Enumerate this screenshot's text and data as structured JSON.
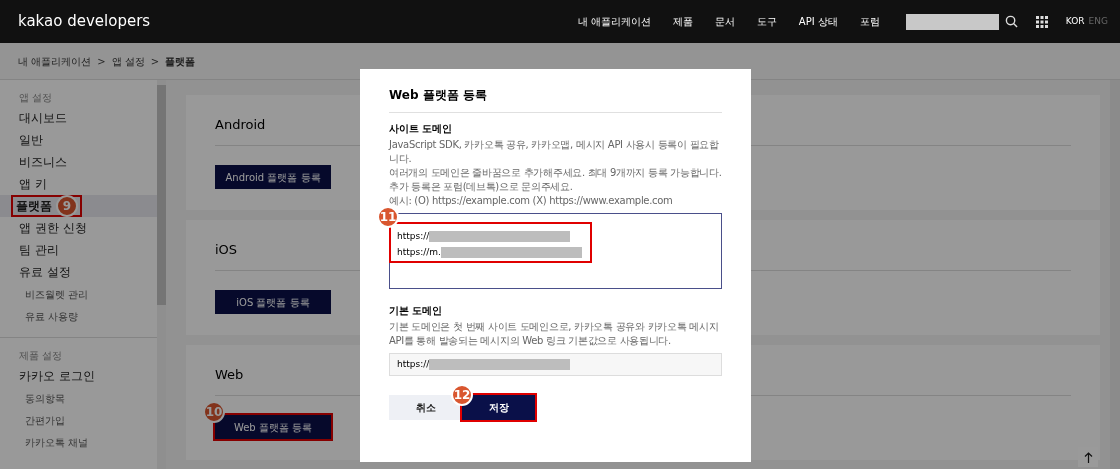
{
  "header": {
    "logo": "kakao developers",
    "nav": [
      {
        "label": "내 애플리케이션"
      },
      {
        "label": "제품"
      },
      {
        "label": "문서"
      },
      {
        "label": "도구"
      },
      {
        "label": "API 상태"
      },
      {
        "label": "포럼"
      }
    ],
    "languages": [
      {
        "label": "KOR",
        "selected": true
      },
      {
        "label": "ENG",
        "selected": false
      }
    ]
  },
  "breadcrumb": {
    "separator": ">",
    "items": [
      "내 애플리케이션",
      "앱 설정",
      "플랫폼"
    ]
  },
  "sidebar": {
    "sections": [
      {
        "title": "앱 설정",
        "items": [
          {
            "label": "대시보드",
            "selected": false
          },
          {
            "label": "일반",
            "selected": false
          },
          {
            "label": "비즈니스",
            "selected": false
          },
          {
            "label": "앱 키",
            "selected": false
          },
          {
            "label": "플랫폼",
            "selected": true,
            "annotation": "9"
          },
          {
            "label": "앱 권한 신청",
            "selected": false
          },
          {
            "label": "팀 관리",
            "selected": false
          },
          {
            "label": "유료 설정",
            "selected": false,
            "children": [
              {
                "label": "비즈월렛 관리",
                "selected": false
              },
              {
                "label": "유료 사용량",
                "selected": false
              }
            ]
          }
        ]
      },
      {
        "title": "제품 설정",
        "items": [
          {
            "label": "카카오 로그인",
            "selected": false,
            "children": [
              {
                "label": "동의항목",
                "selected": false
              },
              {
                "label": "간편가입",
                "selected": false
              },
              {
                "label": "카카오톡 채널",
                "selected": false
              }
            ]
          }
        ]
      }
    ]
  },
  "platforms": [
    {
      "title": "Android",
      "button": "Android 플랫폼 등록"
    },
    {
      "title": "iOS",
      "button": "iOS 플랫폼 등록"
    },
    {
      "title": "Web",
      "button": "Web 플랫폼 등록",
      "annotation": "10"
    }
  ],
  "dialog": {
    "title": "Web 플랫폼 등록",
    "site_domain": {
      "label": "사이트 도메인",
      "help": [
        "JavaScript SDK, 카카오톡 공유, 카카오맵, 메시지 API 사용시 등록이 필요합니다.",
        "여러개의 도메인은 줄바꿈으로 추가해주세요. 최대 9개까지 등록 가능합니다. 추가 등록은 포럼(데브톡)으로 문의주세요.",
        "예시: (O) https://example.com (X) https://www.example.com"
      ],
      "lines": [
        "https://",
        "https://m."
      ],
      "annotation": "11"
    },
    "default_domain": {
      "label": "기본 도메인",
      "help": "기본 도메인은 첫 번째 사이트 도메인으로, 카카오톡 공유와 카카오톡 메시지 API를 통해 발송되는 메시지의 Web 링크 기본값으로 사용됩니다.",
      "value": "https://"
    },
    "buttons": [
      {
        "label": "취소",
        "kind": "secondary"
      },
      {
        "label": "저장",
        "kind": "primary",
        "annotation": "12"
      }
    ]
  }
}
